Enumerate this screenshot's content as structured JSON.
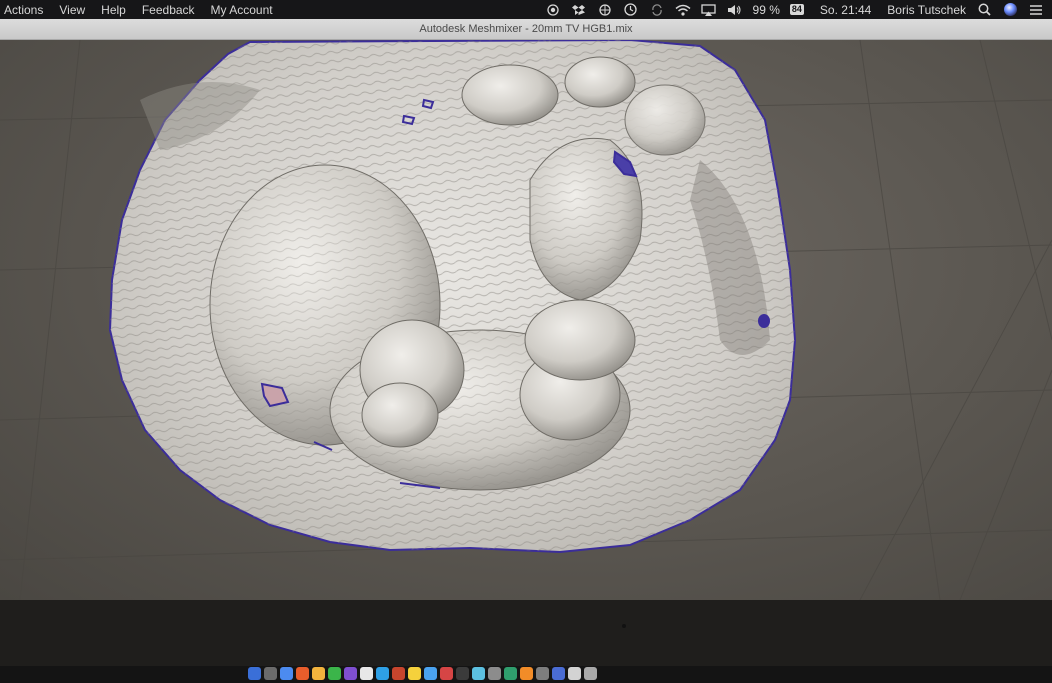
{
  "menubar": {
    "items": [
      "Actions",
      "View",
      "Help",
      "Feedback",
      "My Account"
    ],
    "battery": "99 %",
    "battery_badge": "84",
    "clock": "So. 21:44",
    "user": "Boris Tutschek"
  },
  "window": {
    "title": "Autodesk Meshmixer - 20mm TV HGB1.mix"
  },
  "viewport": {
    "background_color": "#5c5852",
    "mesh_color": "#d9d6d0",
    "boundary_color": "#3b2d9a"
  },
  "icons": {
    "tray": [
      "record-icon",
      "dropbox-icon",
      "wheel-icon",
      "clock-icon",
      "sync-icon",
      "wifi-icon",
      "airplay-icon",
      "volume-icon",
      "search-icon",
      "siri-icon",
      "list-icon"
    ]
  },
  "dock": {
    "icon_colors": [
      "#3a6fd8",
      "#6b6b6b",
      "#4c8bf0",
      "#e85d2b",
      "#f2b33d",
      "#3bb54a",
      "#7f4fd1",
      "#e8e8e8",
      "#2ea0e6",
      "#c7452d",
      "#f5d13c",
      "#4aa3f0",
      "#d64545",
      "#3b3b3b",
      "#5cc0e0",
      "#8c8c8c",
      "#2f9e6d",
      "#f28c28",
      "#7d7d7d",
      "#4a6cd4",
      "#d3d3d3",
      "#a9a9a9"
    ]
  }
}
